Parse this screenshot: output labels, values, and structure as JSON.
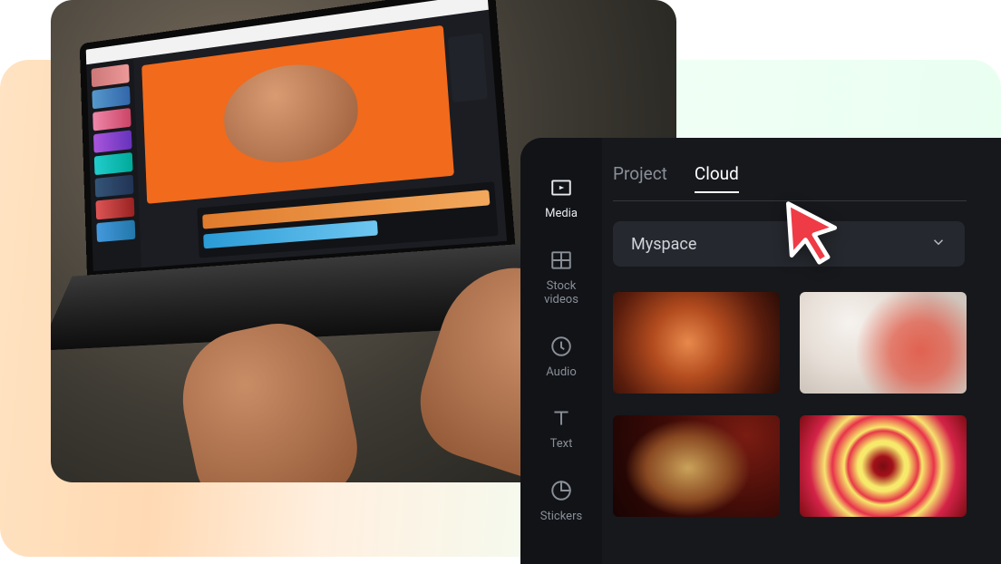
{
  "sidenav": {
    "items": [
      {
        "key": "media",
        "label": "Media",
        "active": true
      },
      {
        "key": "stock",
        "label": "Stock videos",
        "active": false
      },
      {
        "key": "audio",
        "label": "Audio",
        "active": false
      },
      {
        "key": "text",
        "label": "Text",
        "active": false
      },
      {
        "key": "stickers",
        "label": "Stickers",
        "active": false
      }
    ]
  },
  "tabs": {
    "items": [
      {
        "key": "project",
        "label": "Project",
        "active": false
      },
      {
        "key": "cloud",
        "label": "Cloud",
        "active": true
      }
    ]
  },
  "dropdown": {
    "selected": "Myspace"
  },
  "cloud_thumbnails": [
    {
      "key": "thumb-rose"
    },
    {
      "key": "thumb-smoke"
    },
    {
      "key": "thumb-portrait"
    },
    {
      "key": "thumb-flower"
    }
  ],
  "colors": {
    "panel_bg": "#16181c",
    "sidenav_bg": "#111317",
    "dropdown_bg": "#25282e",
    "text_muted": "#8a8f98",
    "text_active": "#ffffff",
    "cursor_fill": "#ef3b45"
  }
}
